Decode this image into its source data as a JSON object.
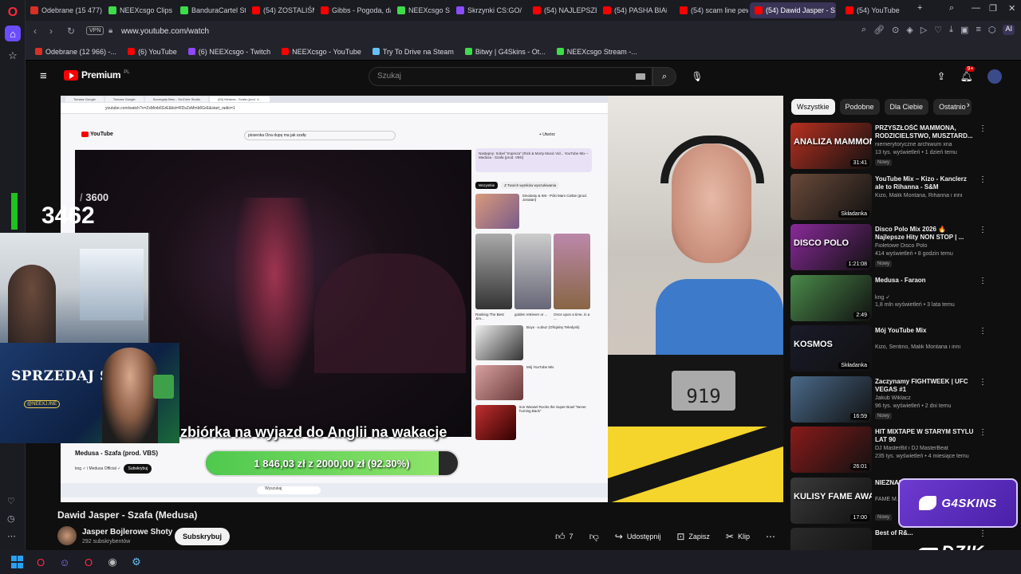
{
  "browser": {
    "tabs": [
      {
        "label": "Odebrane (15 477)",
        "color": "#d93025"
      },
      {
        "label": "NEEXcsgo Clips - Tw",
        "color": "#3ddc4a"
      },
      {
        "label": "BanduraCartel Stre",
        "color": "#3ddc4a"
      },
      {
        "label": "(54) ZOSTALIŚMY O",
        "color": "#ff0000"
      },
      {
        "label": "Gibbs - Pogoda, da",
        "color": "#ff0000"
      },
      {
        "label": "NEEXcsgo Stream",
        "color": "#3ddc4a"
      },
      {
        "label": "Skrzynki CS:GO/CS",
        "color": "#8a4cff"
      },
      {
        "label": "(54) NAJLEPSZE M",
        "color": "#ff0000"
      },
      {
        "label": "(54) PASHA BIAŁA",
        "color": "#ff0000"
      },
      {
        "label": "(54) scam line pew",
        "color": "#ff0000"
      },
      {
        "label": "(54) Dawid Jasper - S",
        "color": "#ff0000"
      },
      {
        "label": "(54) YouTube",
        "color": "#ff0000"
      }
    ],
    "new_tab": "+",
    "url": "www.youtube.com/watch",
    "vpn": "VPN",
    "aria": "AI",
    "bookmarks": [
      {
        "label": "Odebrane (12 966) -...",
        "color": "#d93025"
      },
      {
        "label": "(6) YouTube",
        "color": "#ff0000"
      },
      {
        "label": "(6) NEEXcsgo - Twitch",
        "color": "#9146ff"
      },
      {
        "label": "NEEXcsgo - YouTube",
        "color": "#ff0000"
      },
      {
        "label": "Try To Drive na Steam",
        "color": "#66c0f4"
      },
      {
        "label": "Bitwy | G4Skins - Ot...",
        "color": "#3ddc4a"
      },
      {
        "label": "NEEXcsgo Stream -...",
        "color": "#3ddc4a"
      }
    ]
  },
  "youtube": {
    "brand": "Premium",
    "region": "PL",
    "search_placeholder": "Szukaj",
    "notifications": "9+",
    "video": {
      "title": "Dawid Jasper - Szafa (Medusa)",
      "channel": "Jasper Bojlerowe Shoty",
      "subscribers": "292 subskrybentów",
      "subscribe_label": "Subskrybuj",
      "likes": "7",
      "share_label": "Udostępnij",
      "save_label": "Zapisz",
      "clip_label": "Klip"
    },
    "chips": [
      "Wszystkie",
      "Podobne",
      "Dla Ciebie",
      "Ostatnio"
    ],
    "recommendations": [
      {
        "title": "PRZYSZŁOŚĆ MAMMONA, RODZICIELSTWO, MUSZTARD...",
        "channel": "niemerytoryczne archiwum xna",
        "meta": "13 tys. wyświetleń • 1 dzień temu",
        "badge": "Nowy",
        "duration": "31:41",
        "thumb_text": "ANALIZA MAMMON",
        "thumb": "#b83020"
      },
      {
        "title": "YouTube Mix – Kizo - Kanclerz ale to Rihanna - S&M",
        "channel": "Kizo, Malik Montana, Rihanna i inni",
        "meta": "",
        "badge": "",
        "duration": "Składanka",
        "thumb_text": "",
        "thumb": "#6a4a3a"
      },
      {
        "title": "Disco Polo Mix 2026 🔥 Najlepsze Hity NON STOP | ...",
        "channel": "Fioletowe Disco Polo",
        "meta": "414 wyświetleń • 8 godzin temu",
        "badge": "Nowy",
        "duration": "1:21:08",
        "thumb_text": "DISCO POLO",
        "thumb": "#8a2a9a"
      },
      {
        "title": "Medusa - Faraon",
        "channel": "kng ✓",
        "meta": "1,8 mln wyświetleń • 3 lata temu",
        "badge": "",
        "duration": "2:49",
        "thumb_text": "",
        "thumb": "#4a8a4a"
      },
      {
        "title": "Mój YouTube Mix",
        "channel": "Kizo, Sentino, Malik Montana i inni",
        "meta": "",
        "badge": "",
        "duration": "Składanka",
        "thumb_text": "KOSMOS",
        "thumb": "#1a1a2a"
      },
      {
        "title": "Zaczynamy FIGHTWEEK | UFC VEGAS #1",
        "channel": "Jakub Wiklacz",
        "meta": "96 tys. wyświetleń • 2 dni temu",
        "badge": "Nowy",
        "duration": "16:59",
        "thumb_text": "",
        "thumb": "#4a6a8a"
      },
      {
        "title": "HIT MIXTAPE W STARYM STYLU LAT 90",
        "channel": "DJ MasterBit i DJ MasterBeat",
        "meta": "235 tys. wyświetleń • 4 miesiące temu",
        "badge": "",
        "duration": "26:01",
        "thumb_text": "",
        "thumb": "#8a1a1a"
      },
      {
        "title": "NIEZNANE AWARD...",
        "channel": "FAME M...",
        "meta": "",
        "badge": "Nowy",
        "duration": "17:00",
        "thumb_text": "KULISY FAME AWARD",
        "thumb": "#3a3a3a"
      },
      {
        "title": "Best of R&...",
        "channel": "",
        "meta": "",
        "badge": "",
        "duration": "",
        "thumb_text": "",
        "thumb": "#2a2a2a"
      }
    ]
  },
  "overlay": {
    "goal": "3600",
    "current": "3462",
    "progress_fraction": 0.96,
    "subtitle": "zbiórka na wyjazd do Anglii na wakacje",
    "donation_text": "1 846,03 zł z 2000,00 zł (92.30%)",
    "donation_fraction": 0.923,
    "skins_title": "SPRZEDAJ SKINY",
    "skins_tag": "@NEEXJ.INE",
    "sponsor": "G4SKINS",
    "sponsor2": "DZIK",
    "lcd_value": "919"
  },
  "shared_screen": {
    "tabs": [
      "Tomasz Google",
      "Tomasz Google",
      "Szczegóły filmu - YouTube Studio",
      "(63) Medusa - Szafa (prod. V..."
    ],
    "url": "youtube.com/watch?v=ZsMmb6GrE&list=RDsZsMmb6GrE&start_radio=1",
    "search": "piosenka Ona dupę ma jak szafę",
    "create": "+ Utwórz",
    "next": "Następny: Sobel \"Impreza\" (Rick & Morty Music Vid... YouTube Mix – Medusa - Szafa (prod. VBS)",
    "chips": [
      "Wszystkie",
      "Z Twoich wyników wyszukiwania"
    ],
    "rec1": "Smolasty & IMI - Póki Mam Ciebie (prod. Jonatan)",
    "video_title": "Medusa - Szafa (prod. VBS)",
    "channel": "kng ✓ i Medusa Official ✓",
    "subscribe": "Subskrybuj",
    "taskbar_search": "Wyszukaj",
    "shorts": [
      "Ranking The Best Jim...",
      "golden retriever or ...",
      "Once upon a time, in a ..."
    ],
    "list": [
      "Boys - Łobuz (Oficjalny Teledysk)",
      "Mój YouTube Mix",
      "Iron Weasel Rocks the Super Bowl \"Never Turning Back\""
    ]
  }
}
